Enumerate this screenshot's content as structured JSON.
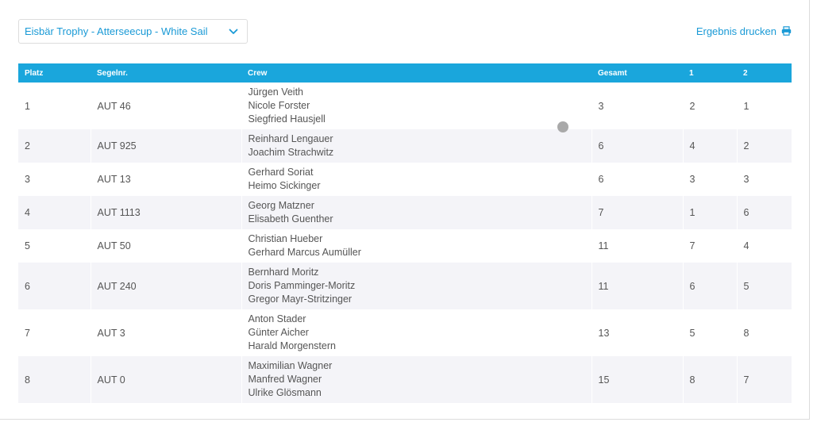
{
  "event_selector": {
    "selected": "Eisbär Trophy - Atterseecup - White Sail"
  },
  "print_link": {
    "label": "Ergebnis drucken"
  },
  "icons": {
    "selector": "chevron-down-icon",
    "print": "printer-icon"
  },
  "colors": {
    "accent": "#1a9ad6",
    "header_bg": "#1aa6dc",
    "row_alt_bg": "#f4f4f8"
  },
  "table": {
    "headers": [
      "Platz",
      "Segelnr.",
      "Crew",
      "Gesamt",
      "1",
      "2"
    ],
    "rows": [
      {
        "platz": "1",
        "segelnr": "AUT 46",
        "crew": [
          "Jürgen Veith",
          "Nicole Forster",
          "Siegfried Hausjell"
        ],
        "gesamt": "3",
        "r1": "2",
        "r2": "1"
      },
      {
        "platz": "2",
        "segelnr": "AUT 925",
        "crew": [
          "Reinhard Lengauer",
          "Joachim Strachwitz"
        ],
        "gesamt": "6",
        "r1": "4",
        "r2": "2"
      },
      {
        "platz": "3",
        "segelnr": "AUT 13",
        "crew": [
          "Gerhard Soriat",
          "Heimo Sickinger"
        ],
        "gesamt": "6",
        "r1": "3",
        "r2": "3"
      },
      {
        "platz": "4",
        "segelnr": "AUT 1113",
        "crew": [
          "Georg Matzner",
          "Elisabeth  Guenther"
        ],
        "gesamt": "7",
        "r1": "1",
        "r2": "6"
      },
      {
        "platz": "5",
        "segelnr": "AUT 50",
        "crew": [
          "Christian Hueber",
          "Gerhard Marcus Aumüller"
        ],
        "gesamt": "11",
        "r1": "7",
        "r2": "4"
      },
      {
        "platz": "6",
        "segelnr": "AUT 240",
        "crew": [
          "Bernhard Moritz",
          "Doris Pamminger-Moritz",
          "Gregor Mayr-Stritzinger"
        ],
        "gesamt": "11",
        "r1": "6",
        "r2": "5"
      },
      {
        "platz": "7",
        "segelnr": "AUT 3",
        "crew": [
          "Anton Stader",
          "Günter Aicher",
          "Harald Morgenstern"
        ],
        "gesamt": "13",
        "r1": "5",
        "r2": "8"
      },
      {
        "platz": "8",
        "segelnr": "AUT 0",
        "crew": [
          "Maximilian Wagner",
          "Manfred Wagner",
          "Ulrike Glösmann"
        ],
        "gesamt": "15",
        "r1": "8",
        "r2": "7"
      }
    ]
  }
}
